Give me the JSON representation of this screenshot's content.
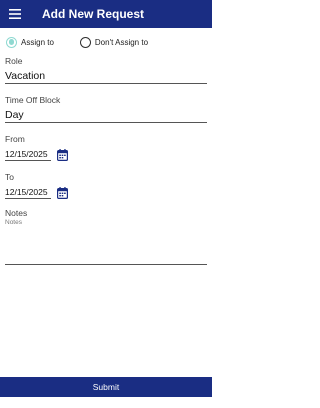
{
  "header": {
    "title": "Add New Request",
    "menu_icon": "hamburger-menu-icon"
  },
  "assignment": {
    "options": [
      {
        "label": "Assign to",
        "selected": true
      },
      {
        "label": "Don't Assign to",
        "selected": false
      }
    ],
    "accent_color": "#8fd9d1"
  },
  "form": {
    "role": {
      "label": "Role",
      "value": "Vacation"
    },
    "time_off_block": {
      "label": "Time Off Block",
      "value": "Day"
    },
    "from": {
      "label": "From",
      "value": "12/15/2025",
      "icon": "calendar-icon"
    },
    "to": {
      "label": "To",
      "value": "12/15/2025",
      "icon": "calendar-icon"
    },
    "notes": {
      "label": "Notes",
      "placeholder": "Notes",
      "value": ""
    }
  },
  "actions": {
    "submit_label": "Submit"
  },
  "colors": {
    "primary": "#1a2d83",
    "text": "#222222"
  }
}
